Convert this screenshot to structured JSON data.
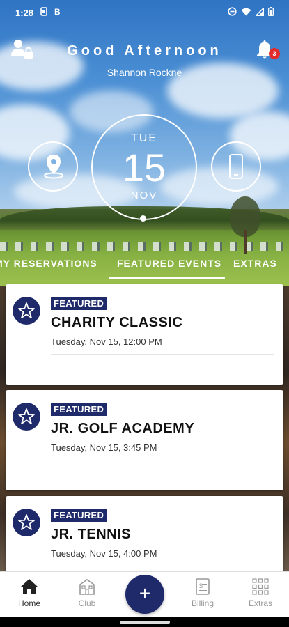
{
  "status_bar": {
    "time": "1:28",
    "left_icons": [
      "sim-icon",
      "b-icon"
    ],
    "right_icons": [
      "dnd-icon",
      "wifi-icon",
      "signal-icon",
      "battery-icon"
    ],
    "b_glyph": "B"
  },
  "header": {
    "greeting": "Good Afternoon",
    "username": "Shannon Rockne",
    "notification_count": "3"
  },
  "date_widget": {
    "weekday": "TUE",
    "day": "15",
    "month": "NOV"
  },
  "quick_actions": [
    "location-pin-icon",
    "phone-icon"
  ],
  "tabs": [
    {
      "label": "MY RESERVATIONS",
      "active": false
    },
    {
      "label": "FEATURED EVENTS",
      "active": true
    },
    {
      "label": "EXTRAS",
      "active": false
    }
  ],
  "events": [
    {
      "tag": "FEATURED",
      "title": "CHARITY CLASSIC",
      "when": "Tuesday, Nov 15, 12:00 PM"
    },
    {
      "tag": "FEATURED",
      "title": "JR. GOLF ACADEMY",
      "when": "Tuesday, Nov 15, 3:45 PM"
    },
    {
      "tag": "FEATURED",
      "title": "JR. TENNIS",
      "when": "Tuesday, Nov 15, 4:00 PM"
    }
  ],
  "bottom_nav": {
    "home": "Home",
    "club": "Club",
    "add": "+",
    "billing": "Billing",
    "extras": "Extras"
  },
  "colors": {
    "brand_navy": "#1f2a6b",
    "badge_red": "#e22b2b"
  }
}
